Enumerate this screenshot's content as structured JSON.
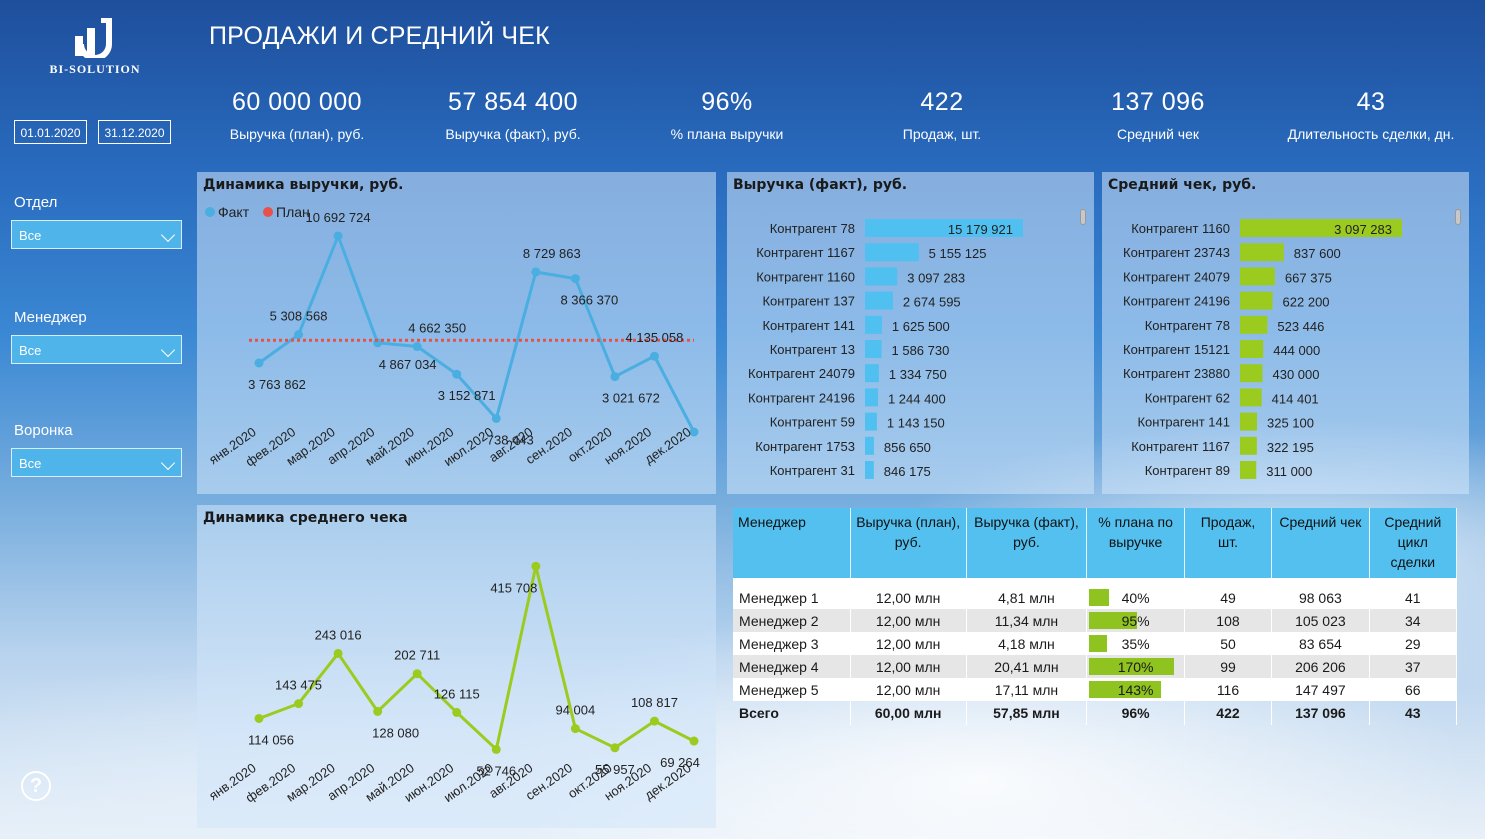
{
  "logo_text": "BI-SOLUTION",
  "page_title": "ПРОДАЖИ И СРЕДНИЙ ЧЕК",
  "date_from": "01.01.2020",
  "date_to": "31.12.2020",
  "filters": [
    {
      "label": "Отдел",
      "value": "Все"
    },
    {
      "label": "Менеджер",
      "value": "Все"
    },
    {
      "label": "Воронка",
      "value": "Все"
    }
  ],
  "kpis": [
    {
      "value": "60 000 000",
      "label": "Выручка (план), руб."
    },
    {
      "value": "57 854 400",
      "label": "Выручка (факт), руб."
    },
    {
      "value": "96%",
      "label": "% плана выручки"
    },
    {
      "value": "422",
      "label": "Продаж, шт."
    },
    {
      "value": "137 096",
      "label": "Средний чек"
    },
    {
      "value": "43",
      "label": "Длительность сделки, дн."
    }
  ],
  "colors": {
    "fact": "#4aaee0",
    "plan": "#e8504a",
    "bar_revenue": "#4fc0ef",
    "bar_check": "#9ccb1f",
    "table_header": "#53c0ef"
  },
  "chart_data": [
    {
      "type": "line",
      "title": "Динамика выручки, руб.",
      "legend": [
        "Факт",
        "План"
      ],
      "legend_position": "top-left",
      "categories": [
        "янв.2020",
        "фев.2020",
        "мар.2020",
        "апр.2020",
        "май.2020",
        "июн.2020",
        "июл.2020",
        "авг.2020",
        "сен.2020",
        "окт.2020",
        "ноя.2020",
        "дек.2020"
      ],
      "series": [
        {
          "name": "Факт",
          "values": [
            3763862,
            5308568,
            10692724,
            4867034,
            4662350,
            3152871,
            738443,
            8729863,
            8366370,
            3021672,
            4135058,
            0
          ]
        },
        {
          "name": "План",
          "values": [
            5000000,
            5000000,
            5000000,
            5000000,
            5000000,
            5000000,
            5000000,
            5000000,
            5000000,
            5000000,
            5000000,
            5000000
          ]
        }
      ],
      "labels": [
        "3 763 862",
        "5 308 568",
        "10 692 724",
        "4 867 034",
        "4 662 350",
        "3 152 871",
        "738 443",
        "8 729 863",
        "8 366 370",
        "3 021 672",
        "4 135 058",
        ""
      ],
      "ylim": [
        0,
        12000000
      ]
    },
    {
      "type": "bar",
      "title": "Выручка (факт), руб.",
      "categories": [
        "Контрагент 78",
        "Контрагент 1167",
        "Контрагент 1160",
        "Контрагент 137",
        "Контрагент 141",
        "Контрагент 13",
        "Контрагент 24079",
        "Контрагент 24196",
        "Контрагент 59",
        "Контрагент 1753",
        "Контрагент 31"
      ],
      "values": [
        15179921,
        5155125,
        3097283,
        2674595,
        1625500,
        1586730,
        1334750,
        1244400,
        1143150,
        856650,
        846175
      ],
      "labels": [
        "15 179 921",
        "5 155 125",
        "3 097 283",
        "2 674 595",
        "1 625 500",
        "1 586 730",
        "1 334 750",
        "1 244 400",
        "1 143 150",
        "856 650",
        "846 175"
      ]
    },
    {
      "type": "bar",
      "title": "Средний чек, руб.",
      "categories": [
        "Контрагент 1160",
        "Контрагент 23743",
        "Контрагент 24079",
        "Контрагент 24196",
        "Контрагент 78",
        "Контрагент 15121",
        "Контрагент 23880",
        "Контрагент 62",
        "Контрагент 141",
        "Контрагент 1167",
        "Контрагент 89"
      ],
      "values": [
        3097283,
        837600,
        667375,
        622200,
        523446,
        444000,
        430000,
        414401,
        325100,
        322195,
        311000
      ],
      "labels": [
        "3 097 283",
        "837 600",
        "667 375",
        "622 200",
        "523 446",
        "444 000",
        "430 000",
        "414 401",
        "325 100",
        "322 195",
        "311 000"
      ]
    },
    {
      "type": "line",
      "title": "Динамика среднего чека",
      "categories": [
        "янв.2020",
        "фев.2020",
        "мар.2020",
        "апр.2020",
        "май.2020",
        "июн.2020",
        "июл.2020",
        "авг.2020",
        "сен.2020",
        "окт.2020",
        "ноя.2020",
        "дек.2020"
      ],
      "series": [
        {
          "values": [
            114056,
            143475,
            243016,
            128080,
            202711,
            126115,
            52746,
            415708,
            94004,
            55957,
            108817,
            69264
          ]
        }
      ],
      "labels": [
        "114 056",
        "143 475",
        "243 016",
        "128 080",
        "202 711",
        "126 115",
        "52 746",
        "415 708",
        "94 004",
        "55 957",
        "108 817",
        "69 264"
      ],
      "ylim": [
        0,
        450000
      ]
    }
  ],
  "table": {
    "headers": [
      "Менеджер",
      "Выручка (план), руб.",
      "Выручка (факт), руб.",
      "% плана по выручке",
      "Продаж, шт.",
      "Средний чек",
      "Средний цикл сделки"
    ],
    "rows": [
      {
        "name": "Менеджер 1",
        "plan": "12,00 млн",
        "fact": "4,81 млн",
        "pct": "40%",
        "pct_value": 0.4,
        "sales": "49",
        "check": "98 063",
        "cycle": "41"
      },
      {
        "name": "Менеджер 2",
        "plan": "12,00 млн",
        "fact": "11,34 млн",
        "pct": "95%",
        "pct_value": 0.95,
        "sales": "108",
        "check": "105 023",
        "cycle": "34"
      },
      {
        "name": "Менеджер 3",
        "plan": "12,00 млн",
        "fact": "4,18 млн",
        "pct": "35%",
        "pct_value": 0.35,
        "sales": "50",
        "check": "83 654",
        "cycle": "29"
      },
      {
        "name": "Менеджер 4",
        "plan": "12,00 млн",
        "fact": "20,41 млн",
        "pct": "170%",
        "pct_value": 1.7,
        "sales": "99",
        "check": "206 206",
        "cycle": "37"
      },
      {
        "name": "Менеджер 5",
        "plan": "12,00 млн",
        "fact": "17,11 млн",
        "pct": "143%",
        "pct_value": 1.43,
        "sales": "116",
        "check": "147 497",
        "cycle": "66"
      }
    ],
    "total": {
      "name": "Всего",
      "plan": "60,00 млн",
      "fact": "57,85 млн",
      "pct": "96%",
      "sales": "422",
      "check": "137 096",
      "cycle": "43"
    }
  },
  "help_icon": "help-icon"
}
